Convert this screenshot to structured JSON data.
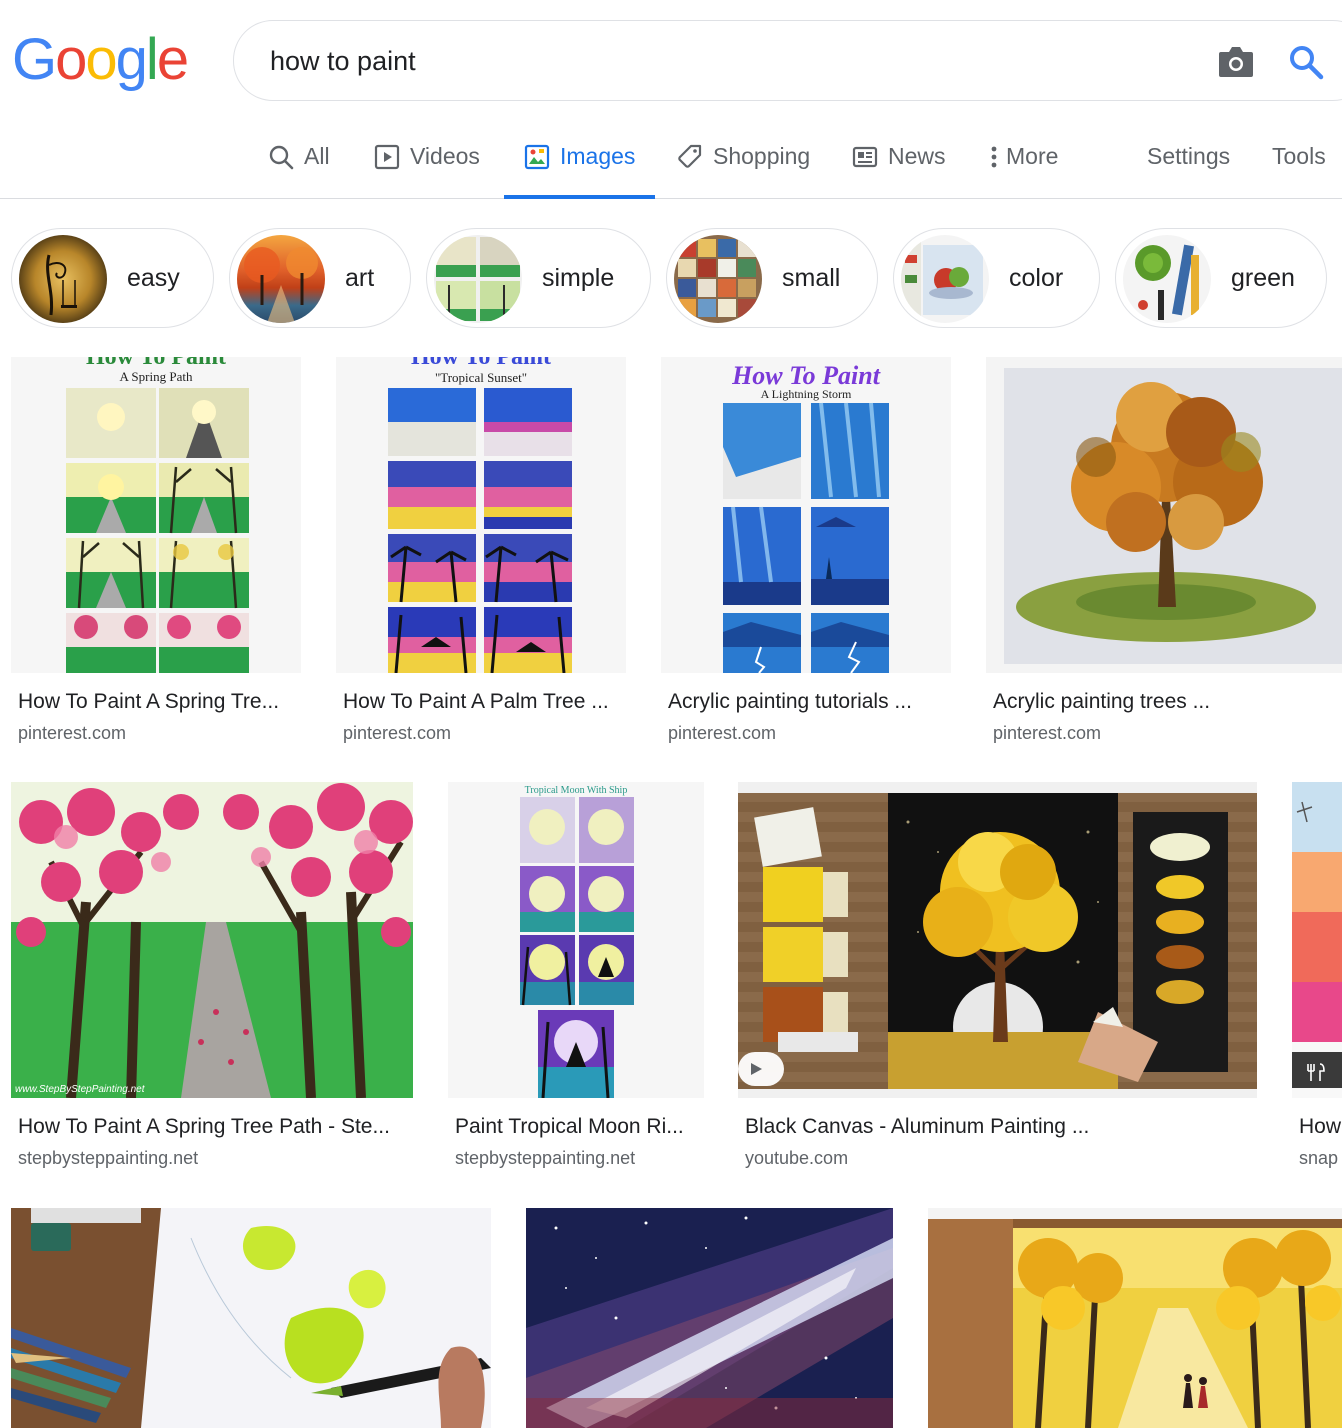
{
  "logo": {
    "text": "Google"
  },
  "search": {
    "query": "how to paint"
  },
  "nav": {
    "items": [
      {
        "label": "All",
        "icon": "search-icon"
      },
      {
        "label": "Videos",
        "icon": "video-icon"
      },
      {
        "label": "Images",
        "icon": "image-icon",
        "active": true
      },
      {
        "label": "Shopping",
        "icon": "tag-icon"
      },
      {
        "label": "News",
        "icon": "news-icon"
      },
      {
        "label": "More",
        "icon": "more-vertical-icon"
      }
    ],
    "settings": "Settings",
    "tools": "Tools"
  },
  "chips": [
    {
      "label": "easy"
    },
    {
      "label": "art"
    },
    {
      "label": "simple"
    },
    {
      "label": "small"
    },
    {
      "label": "color"
    },
    {
      "label": "green"
    }
  ],
  "results": [
    {
      "title": "How To Paint A Spring Tre...",
      "domain": "pinterest.com",
      "heading": "How To Paint",
      "subheading": "A Spring Path"
    },
    {
      "title": "How To Paint A Palm Tree ...",
      "domain": "pinterest.com",
      "heading": "How To Paint",
      "subheading": "\"Tropical Sunset\""
    },
    {
      "title": "Acrylic painting tutorials ...",
      "domain": "pinterest.com",
      "heading": "How To Paint",
      "subheading": "A Lightning Storm"
    },
    {
      "title": "Acrylic painting trees ...",
      "domain": "pinterest.com"
    },
    {
      "title": "How To Paint A Spring Tree Path - Ste...",
      "domain": "stepbysteppainting.net",
      "watermark": "www.StepByStepPainting.net"
    },
    {
      "title": "Paint Tropical Moon Ri...",
      "domain": "stepbysteppainting.net",
      "heading": "Tropical Moon With Ship"
    },
    {
      "title": "Black Canvas - Aluminum Painting ...",
      "domain": "youtube.com"
    },
    {
      "title": "How",
      "domain": "snap"
    },
    {
      "title": "",
      "domain": ""
    },
    {
      "title": "",
      "domain": ""
    },
    {
      "title": "",
      "domain": ""
    }
  ],
  "colors": {
    "accent": "#1a73e8",
    "text": "#202124",
    "muted": "#5f6368",
    "border": "#dfe1e5"
  }
}
